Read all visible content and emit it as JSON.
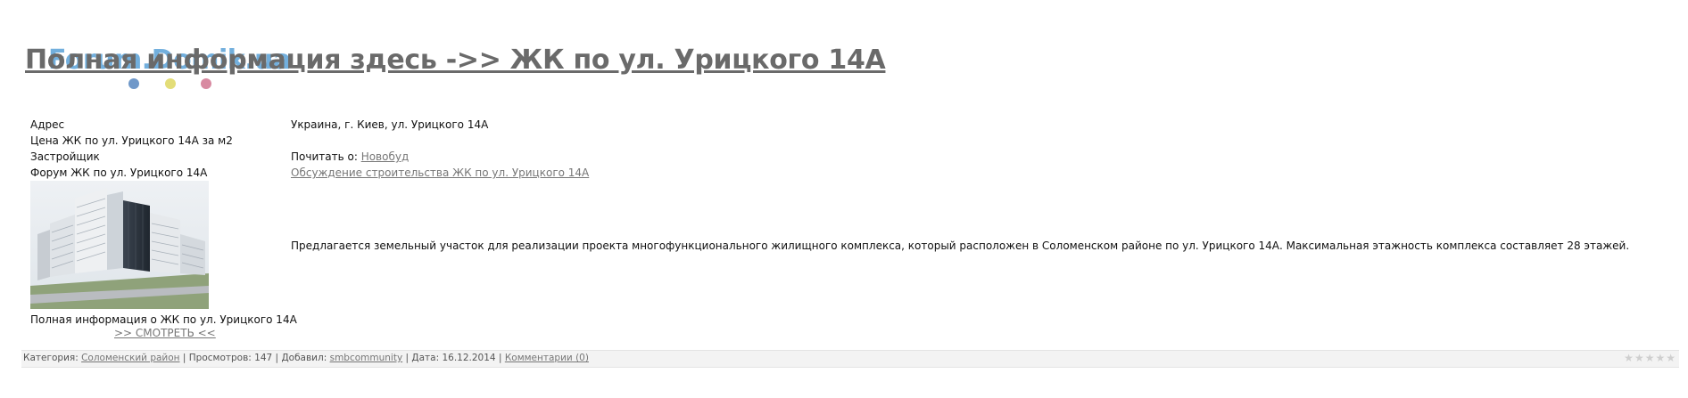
{
  "logo": {
    "text": "Forum.Domik.ua"
  },
  "title": "Полная информация здесь ->> ЖК по ул. Урицкого 14А",
  "details": {
    "address_label": "Адрес",
    "address_value": "Украина, г. Киев, ул. Урицкого 14А",
    "price_label": "Цена ЖК по ул. Урицкого 14А за м2",
    "developer_label": "Застройщик",
    "developer_prefix": "Почитать о:",
    "developer_link": "Новобуд",
    "forum_label": "Форум ЖК по ул. Урицкого 14А",
    "forum_link": "Обсуждение строительства ЖК по ул. Урицкого 14А"
  },
  "description": "Предлагается земельный участок для реализации проекта многофункционального жилищного комплекса, который расположен в Соломенском районе по ул. Урицкого 14А. Максимальная этажность комплекса составляет 28 этажей.",
  "image_caption": "Полная информация о ЖК по ул. Урицкого 14А",
  "view_link": ">> СМОТРЕТЬ <<",
  "footer": {
    "category_label": "Категория:",
    "category_link": "Соломенский район",
    "sep": "|",
    "views": "Просмотров: 147",
    "added_label": "Добавил:",
    "added_link": "smbcommunity",
    "date": "Дата: 16.12.2014",
    "comments_link": "Комментарии (0)"
  },
  "rating": {
    "stars_total": 5,
    "stars_filled": 0
  },
  "icons": {
    "star": "star-icon"
  },
  "colors": {
    "link": "#777777",
    "logo": "#5aa2d8",
    "bar_bg": "#f3f3f3"
  }
}
